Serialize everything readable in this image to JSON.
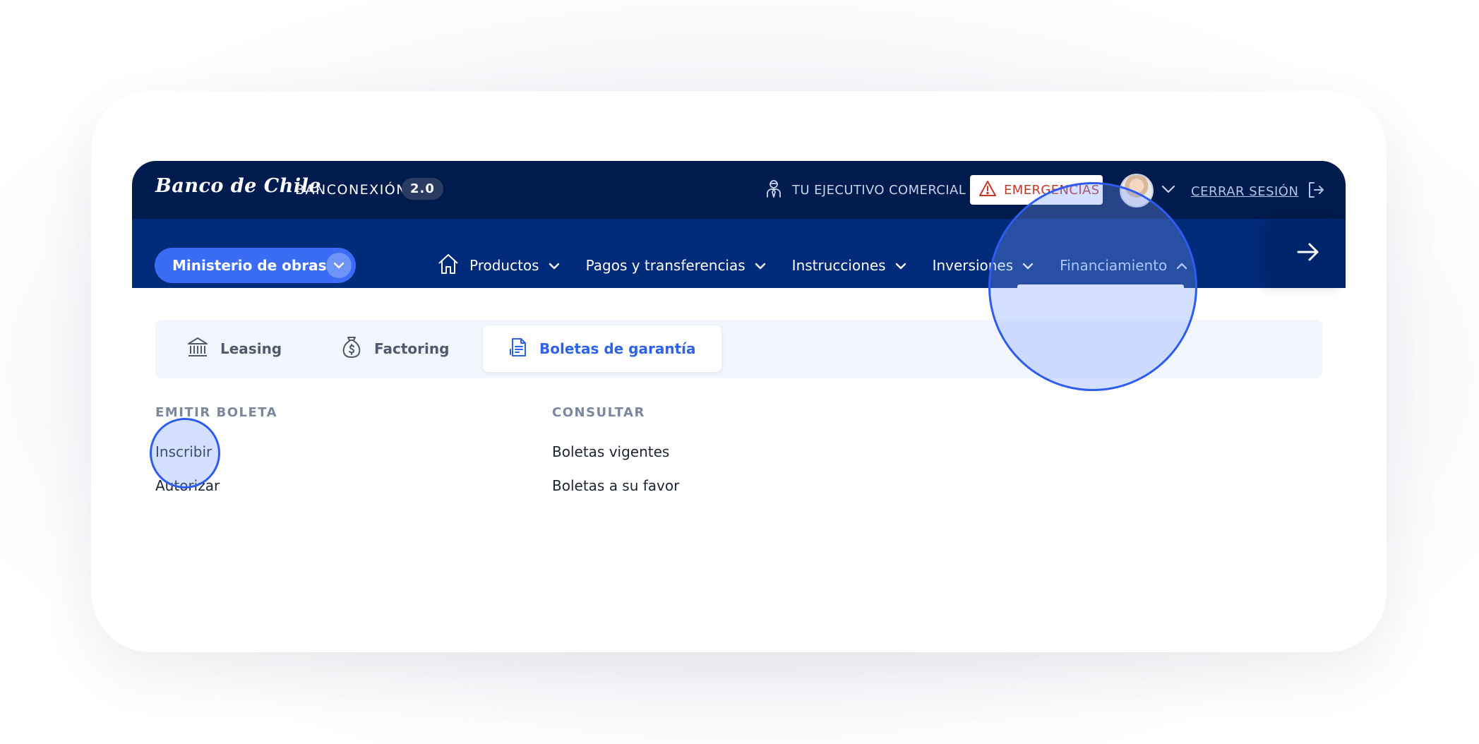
{
  "topbar": {
    "logo": "Banco de Chile",
    "brand": "BANCONEXIÓN",
    "version": "2.0",
    "executive_label": "TU EJECUTIVO COMERCIAL",
    "emergency_label": "EMERGENCIAS",
    "logout_label": "CERRAR SESIÓN"
  },
  "navbar": {
    "company": "Ministerio de obras....",
    "items": [
      {
        "label": "Productos"
      },
      {
        "label": "Pagos y transferencias"
      },
      {
        "label": "Instrucciones"
      },
      {
        "label": "Inversiones"
      },
      {
        "label": "Financiamiento"
      }
    ]
  },
  "subtabs": [
    {
      "label": "Leasing"
    },
    {
      "label": "Factoring"
    },
    {
      "label": "Boletas de garantía"
    }
  ],
  "columns": [
    {
      "heading": "EMITIR BOLETA",
      "links": [
        "Inscribir",
        "Autorizar"
      ]
    },
    {
      "heading": "CONSULTAR",
      "links": [
        "Boletas vigentes",
        "Boletas a su favor"
      ]
    }
  ],
  "colors": {
    "topbar": "#001b4d",
    "navbar": "#002a7a",
    "accent": "#2e62eb",
    "emergency": "#c0392b"
  },
  "icons": [
    "executive-icon",
    "warning-icon",
    "chevron-down-icon",
    "logout-icon",
    "home-icon",
    "chevron-up-icon",
    "arrow-right-icon",
    "bank-icon",
    "money-bag-icon",
    "document-icon"
  ]
}
